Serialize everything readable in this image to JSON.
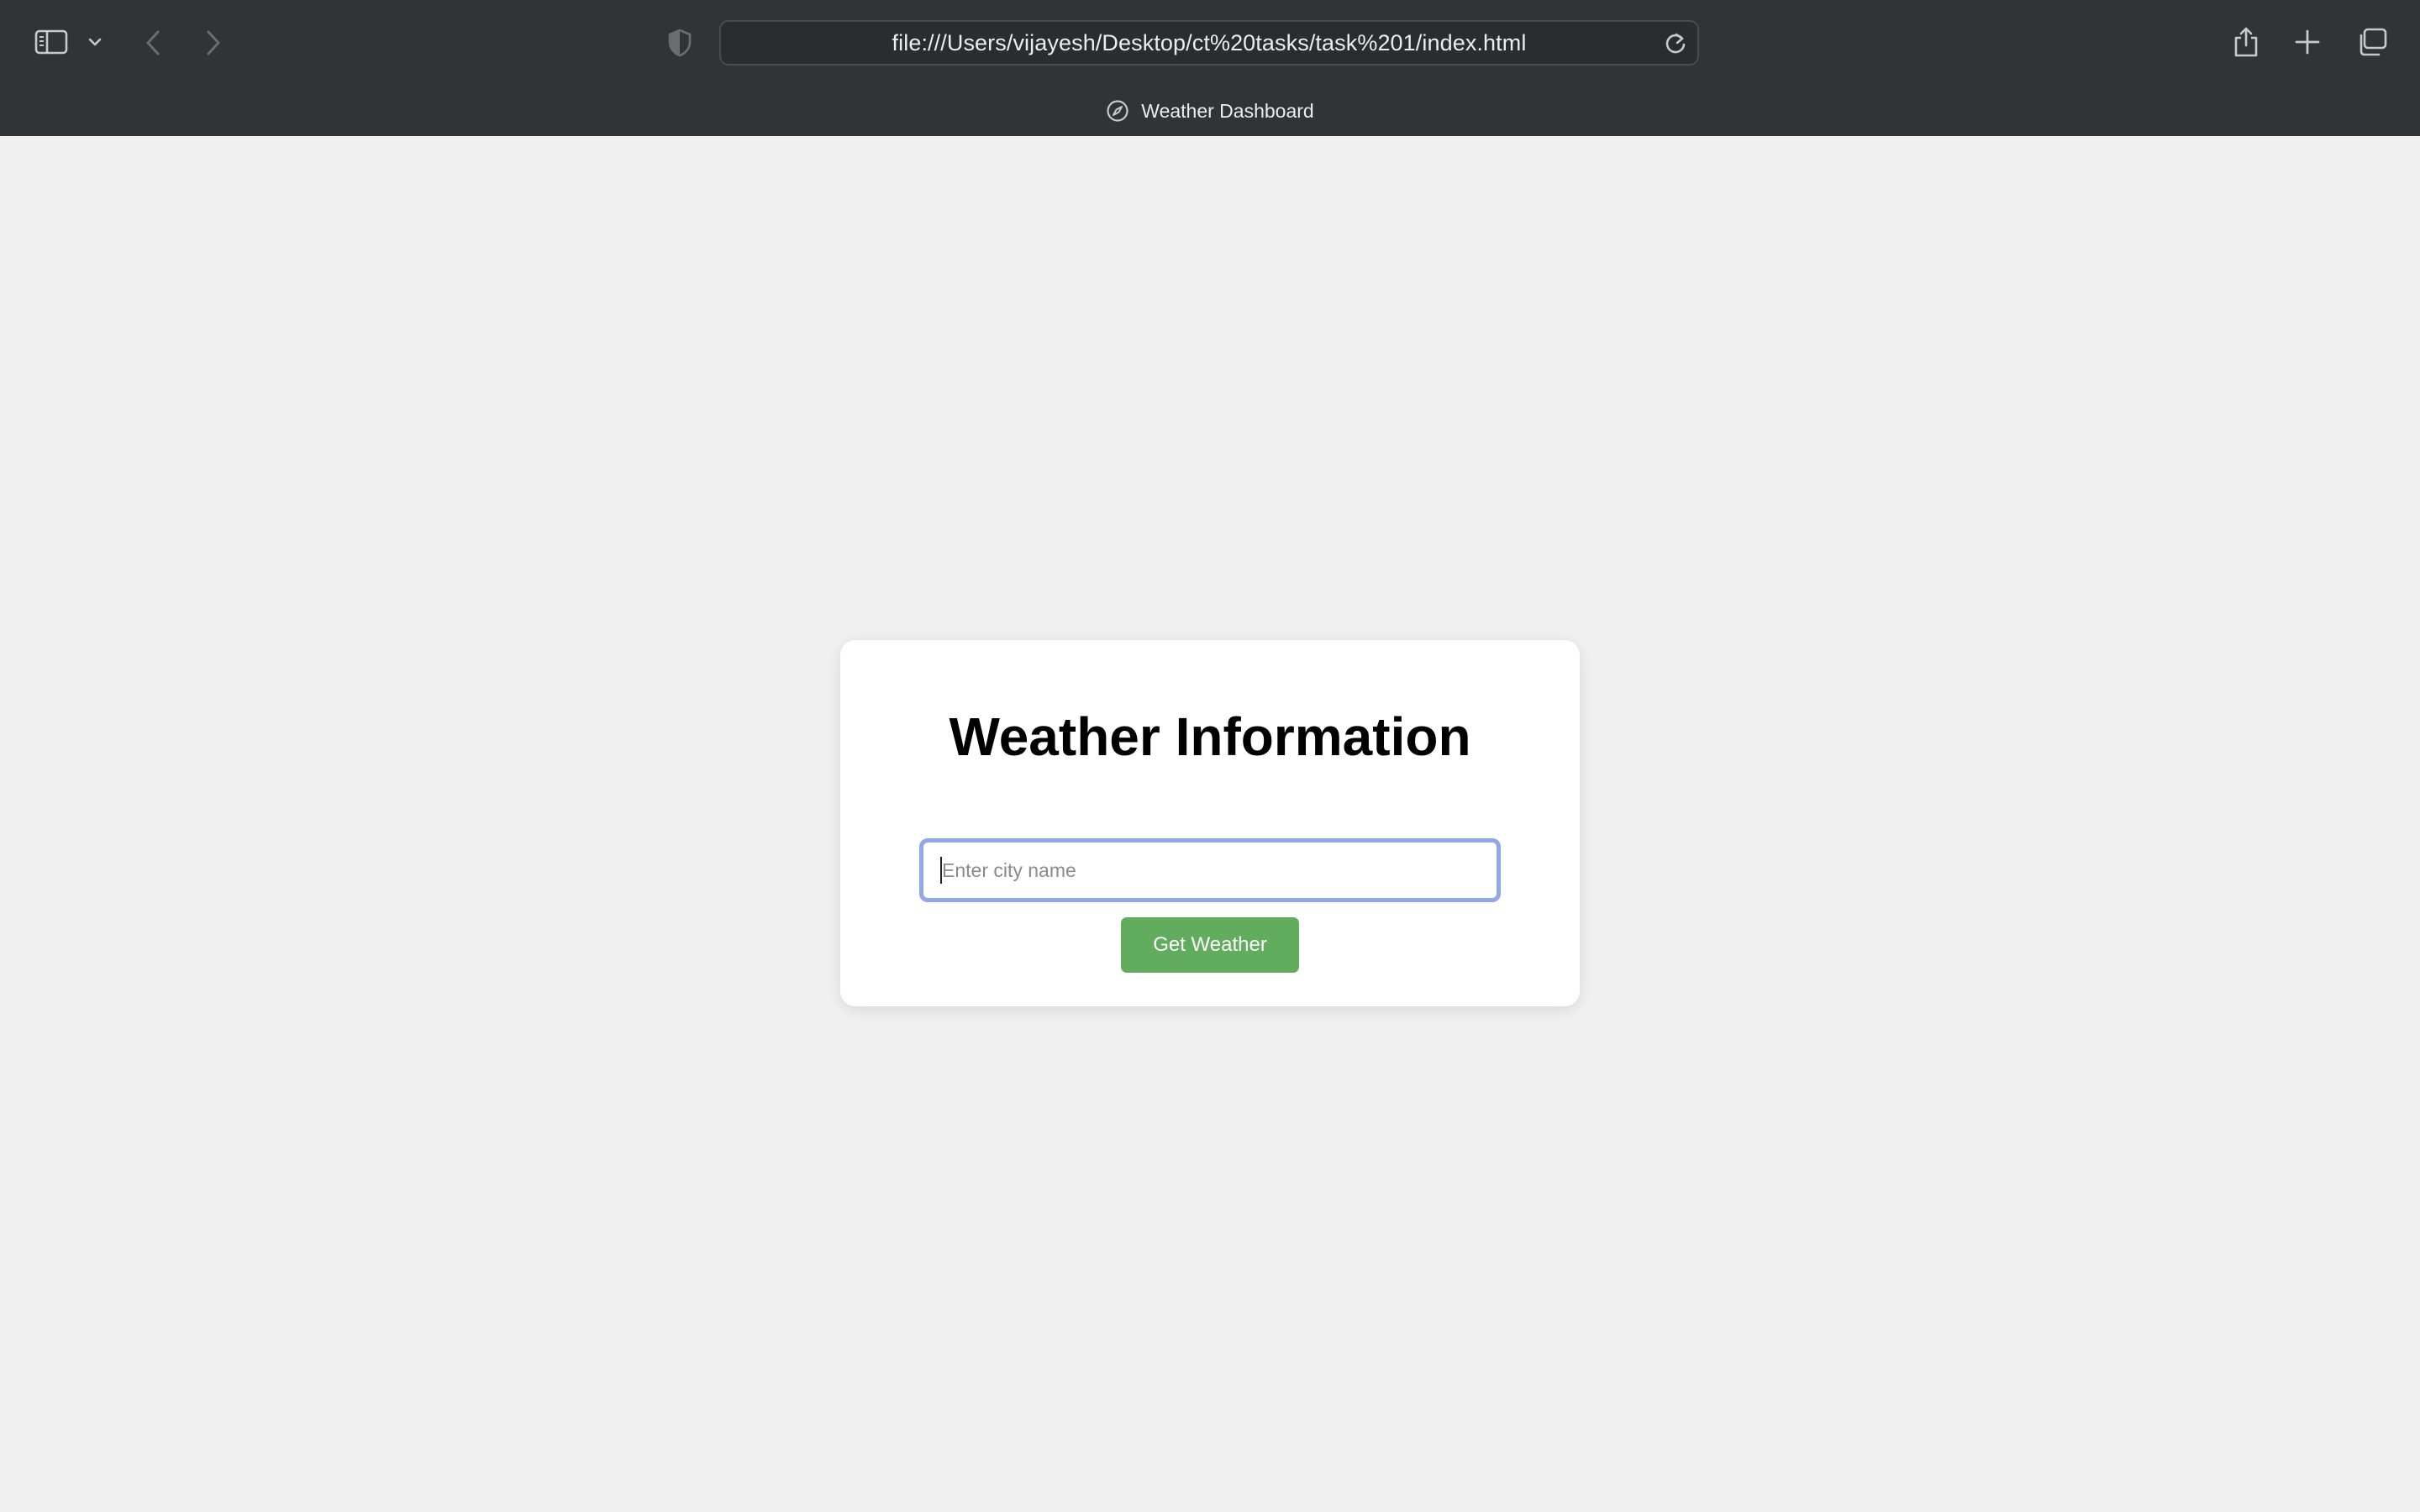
{
  "browser": {
    "url": "file:///Users/vijayesh/Desktop/ct%20tasks/task%201/index.html",
    "tab_title": "Weather Dashboard",
    "icons": {
      "sidebar": "sidebar-icon",
      "sidebar_menu": "chevron-down-icon",
      "back": "chevron-left-icon",
      "forward": "chevron-right-icon",
      "privacy": "shield-icon",
      "reload": "reload-icon",
      "share": "share-icon",
      "new_tab": "plus-icon",
      "tab_overview": "tabs-overview-icon",
      "tab_favicon": "compass-icon"
    }
  },
  "page": {
    "title": "Weather Information",
    "search": {
      "value": "",
      "placeholder": "Enter city name"
    },
    "button_label": "Get Weather"
  },
  "colors": {
    "chrome_background": "#323335",
    "page_background": "#f0f0f0",
    "card_background": "#ffffff",
    "input_focus_border": "#90a8ea",
    "button_background": "#62ad5d",
    "button_text": "#ffffff"
  }
}
